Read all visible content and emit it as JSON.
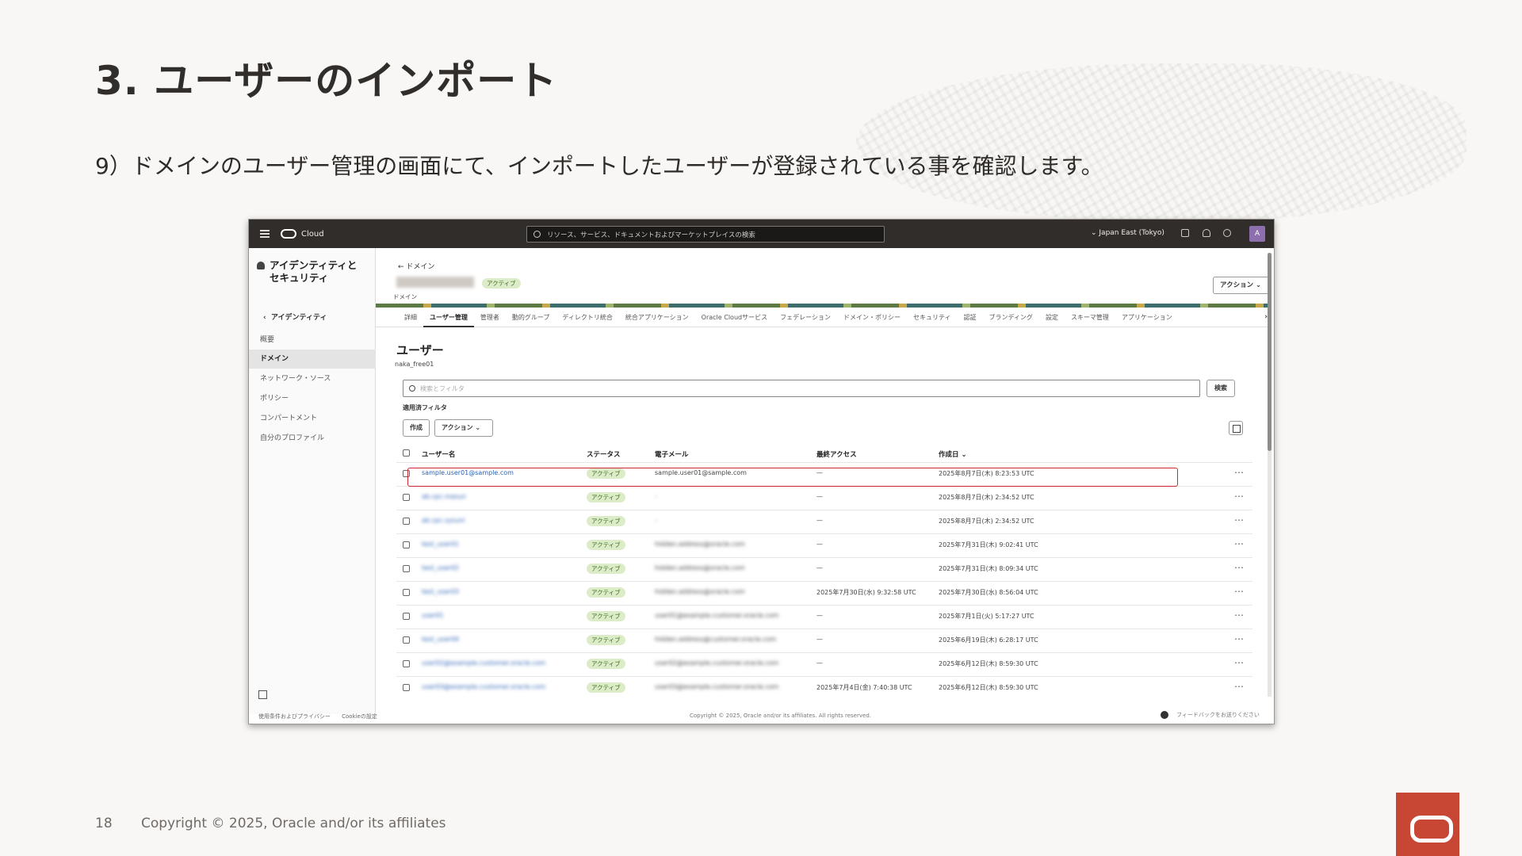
{
  "slide": {
    "title": "3. ユーザーのインポート",
    "instruction": "9）ドメインのユーザー管理の画面にて、インポートしたユーザーが登録されている事を確認します。",
    "page_number": "18",
    "copyright": "Copyright © 2025, Oracle and/or its affiliates"
  },
  "topbar": {
    "brand": "Cloud",
    "search_placeholder": "リソース、サービス、ドキュメントおよびマーケットプレイスの検索",
    "region": "Japan East (Tokyo)",
    "avatar_initial": "A"
  },
  "sidebar": {
    "heading_line1": "アイデンティティと",
    "heading_line2": "セキュリティ",
    "back_label": "アイデンティティ",
    "items": [
      "概要",
      "ドメイン",
      "ネットワーク・ソース",
      "ポリシー",
      "コンパートメント",
      "自分のプロファイル"
    ],
    "active_item": "ドメイン"
  },
  "header": {
    "breadcrumb": "← ドメイン",
    "domain_status": "アクティブ",
    "domain_label": "ドメイン",
    "actions_label": "アクション ⌄"
  },
  "tabs": [
    "詳細",
    "ユーザー管理",
    "管理者",
    "動的グループ",
    "ディレクトリ統合",
    "統合アプリケーション",
    "Oracle Cloudサービス",
    "フェデレーション",
    "ドメイン・ポリシー",
    "セキュリティ",
    "認証",
    "ブランディング",
    "設定",
    "スキーマ管理",
    "アプリケーション"
  ],
  "active_tab": "ユーザー管理",
  "users": {
    "title": "ユーザー",
    "subtitle": "naka_free01",
    "search_placeholder": "検索とフィルタ",
    "search_button": "検索",
    "filter_label": "適用済フィルタ",
    "create_button": "作成",
    "actions_button": "アクション ⌄",
    "columns": {
      "username": "ユーザー名",
      "status": "ステータス",
      "email": "電子メール",
      "last_access": "最終アクセス",
      "created": "作成日 ⌄"
    },
    "rows": [
      {
        "username": "sample.user01@sample.com",
        "status": "アクティブ",
        "email": "sample.user01@sample.com",
        "last_access": "—",
        "created": "2025年8月7日(木) 8:23:53 UTC",
        "blur": false
      },
      {
        "username": "ab.cpc.masun",
        "status": "アクティブ",
        "email": "-",
        "last_access": "—",
        "created": "2025年8月7日(木) 2:34:52 UTC",
        "blur": true
      },
      {
        "username": "ab.cpc.sysuni",
        "status": "アクティブ",
        "email": "-",
        "last_access": "—",
        "created": "2025年8月7日(木) 2:34:52 UTC",
        "blur": true
      },
      {
        "username": "test_user01",
        "status": "アクティブ",
        "email": "hidden.address@oracle.com",
        "last_access": "—",
        "created": "2025年7月31日(木) 9:02:41 UTC",
        "blur": true
      },
      {
        "username": "test_user02",
        "status": "アクティブ",
        "email": "hidden.address@oracle.com",
        "last_access": "—",
        "created": "2025年7月31日(木) 8:09:34 UTC",
        "blur": true
      },
      {
        "username": "test_user03",
        "status": "アクティブ",
        "email": "hidden.address@oracle.com",
        "last_access": "2025年7月30日(水) 9:32:58 UTC",
        "created": "2025年7月30日(水) 8:56:04 UTC",
        "blur": true
      },
      {
        "username": "user01",
        "status": "アクティブ",
        "email": "user01@example.customer.oracle.com",
        "last_access": "—",
        "created": "2025年7月1日(火) 5:17:27 UTC",
        "blur": true
      },
      {
        "username": "test_user04",
        "status": "アクティブ",
        "email": "hidden.address@customer.oracle.com",
        "last_access": "—",
        "created": "2025年6月19日(木) 6:28:17 UTC",
        "blur": true
      },
      {
        "username": "user02@example.customer.oracle.com",
        "status": "アクティブ",
        "email": "user02@example.customer.oracle.com",
        "last_access": "—",
        "created": "2025年6月12日(木) 8:59:30 UTC",
        "blur": true
      },
      {
        "username": "user03@example.customer.oracle.com",
        "status": "アクティブ",
        "email": "user03@example.customer.oracle.com",
        "last_access": "2025年7月4日(金) 7:40:38 UTC",
        "created": "2025年6月12日(木) 8:59:30 UTC",
        "blur": true
      }
    ]
  },
  "footer": {
    "terms": "使用条件およびプライバシー",
    "cookies": "Cookieの設定",
    "copyright": "Copyright © 2025, Oracle and/or its affiliates. All rights reserved.",
    "feedback": "フィードバックをお送りください"
  },
  "colors": {
    "accent_red": "#c74634",
    "highlight_red": "#d0262f",
    "topbar": "#312d2a",
    "link": "#2b62b5"
  }
}
